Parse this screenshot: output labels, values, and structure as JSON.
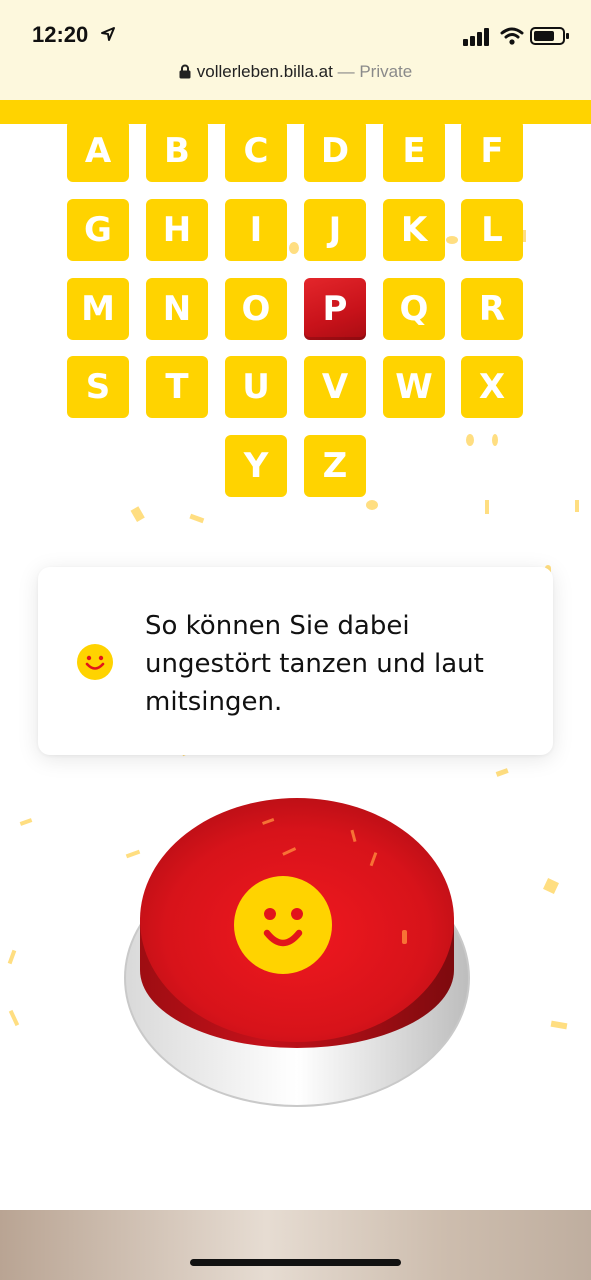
{
  "status_bar": {
    "time": "12:20"
  },
  "browser": {
    "url": "vollerleben.billa.at",
    "separator": " — ",
    "mode": "Private"
  },
  "letters": [
    "A",
    "B",
    "C",
    "D",
    "E",
    "F",
    "G",
    "H",
    "I",
    "J",
    "K",
    "L",
    "M",
    "N",
    "O",
    "P",
    "Q",
    "R",
    "S",
    "T",
    "U",
    "V",
    "W",
    "X",
    "Y",
    "Z"
  ],
  "selected_letter": "P",
  "card": {
    "icon": "smiley-icon",
    "text": "So können Sie dabei ungestört tanzen und laut mitsingen."
  },
  "big_button": {
    "icon": "smiley-face-icon"
  },
  "colors": {
    "brand_yellow": "#ffd300",
    "brand_red": "#e2141b"
  }
}
